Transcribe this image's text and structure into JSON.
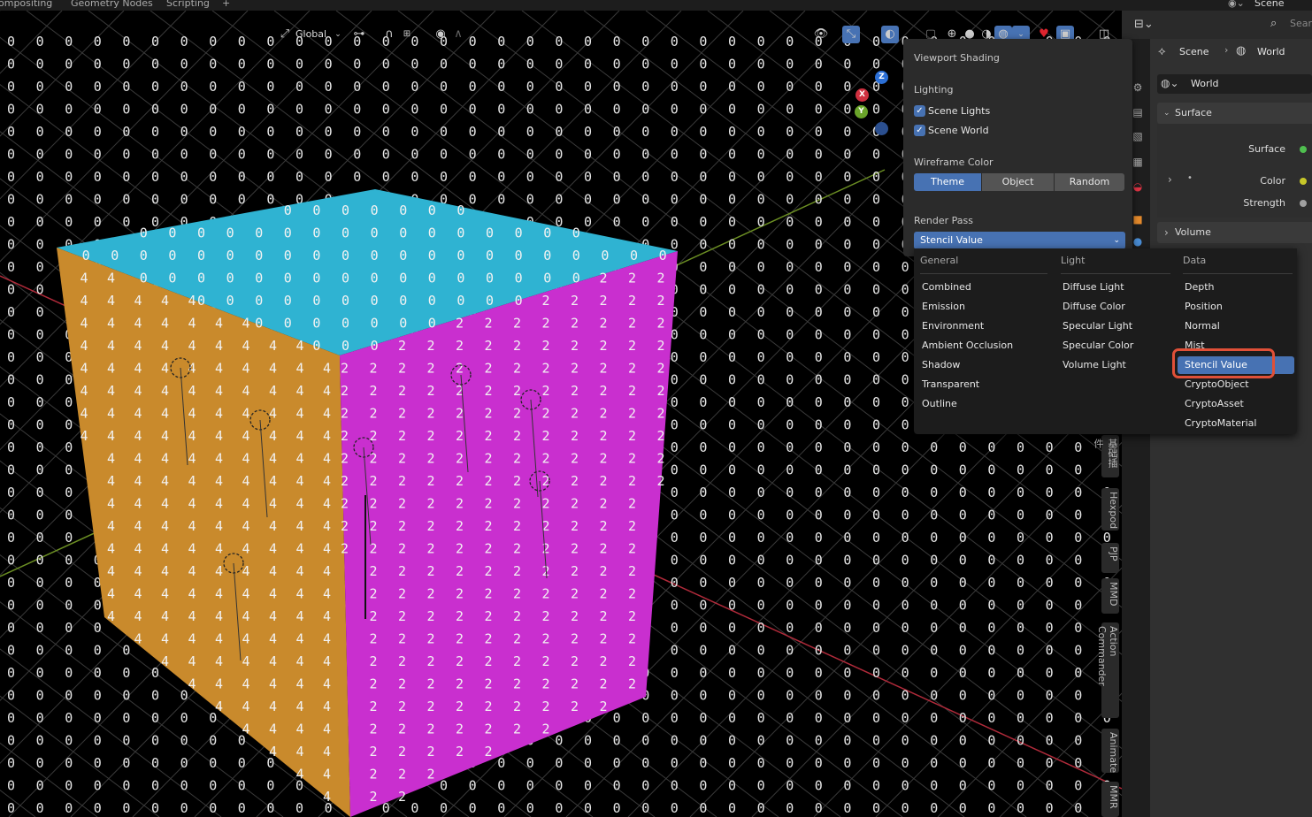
{
  "workspace_tabs": [
    "ompositing",
    "Geometry Nodes",
    "Scripting",
    "+"
  ],
  "scene_selector": "Scene",
  "search_placeholder": "Sear",
  "header": {
    "orientation": "Global",
    "pivot_icon": "pivot-icon",
    "snap_icon": "magnet-icon"
  },
  "gizmo": {
    "z": "Z",
    "x": "X",
    "y": "Y"
  },
  "side_tabs": [
    "基础插件",
    "Hexpod",
    "PJP",
    "MMD",
    "Action Commander",
    "Animate",
    "MMR"
  ],
  "properties": {
    "breadcrumb_scene": "Scene",
    "breadcrumb_world": "World",
    "world_name": "World",
    "surface_section": "Surface",
    "surface_label": "Surface",
    "color_label": "Color",
    "strength_label": "Strength",
    "volume_section": "Volume"
  },
  "shading": {
    "title": "Viewport Shading",
    "lighting_title": "Lighting",
    "scene_lights": "Scene Lights",
    "scene_world": "Scene World",
    "wire_title": "Wireframe Color",
    "wire_options": [
      "Theme",
      "Object",
      "Random"
    ],
    "wire_selected": "Theme",
    "render_pass_title": "Render Pass",
    "render_pass_value": "Stencil Value"
  },
  "render_pass_menu": {
    "general_header": "General",
    "light_header": "Light",
    "data_header": "Data",
    "general": [
      "Combined",
      "Emission",
      "Environment",
      "Ambient Occlusion",
      "Shadow",
      "Transparent",
      "Outline"
    ],
    "light": [
      "Diffuse Light",
      "Diffuse Color",
      "Specular Light",
      "Specular Color",
      "Volume Light"
    ],
    "data": [
      "Depth",
      "Position",
      "Normal",
      "Mist",
      "Stencil Value",
      "CryptoObject",
      "CryptoAsset",
      "CryptoMaterial"
    ],
    "selected": "Stencil Value"
  },
  "cube_face_values": {
    "top": "0",
    "left": "4",
    "right": "2",
    "background": "0"
  },
  "colors": {
    "cube_top": "#2fb3d2",
    "cube_left": "#c98a2c",
    "cube_right": "#c92fcf",
    "accent": "#4772b3",
    "highlight": "#e05038"
  }
}
